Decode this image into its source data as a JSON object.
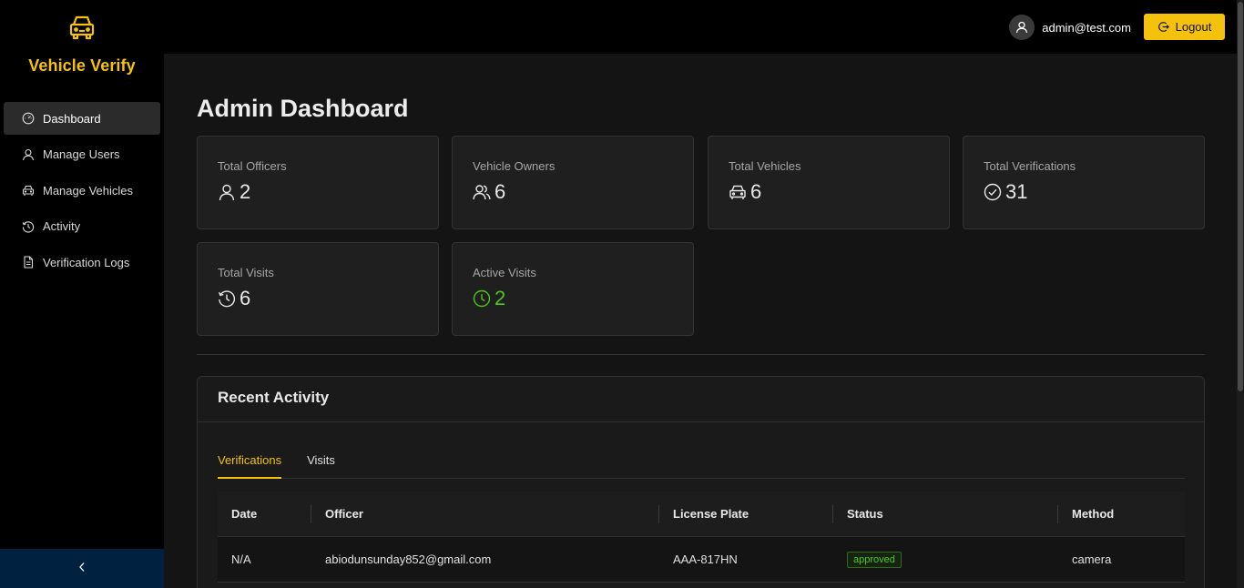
{
  "sidebar": {
    "brand": "Vehicle Verify",
    "items": [
      {
        "label": "Dashboard",
        "icon": "dashboard-icon",
        "active": true
      },
      {
        "label": "Manage Users",
        "icon": "user-icon"
      },
      {
        "label": "Manage Vehicles",
        "icon": "car-icon"
      },
      {
        "label": "Activity",
        "icon": "history-icon"
      },
      {
        "label": "Verification Logs",
        "icon": "file-icon"
      }
    ],
    "collapse_icon": "chevron-left-icon"
  },
  "header": {
    "user_email": "admin@test.com",
    "logout_label": "Logout"
  },
  "main": {
    "title": "Admin Dashboard",
    "stats": [
      {
        "label": "Total Officers",
        "value": "2",
        "icon": "user-icon"
      },
      {
        "label": "Vehicle Owners",
        "value": "6",
        "icon": "team-icon"
      },
      {
        "label": "Total Vehicles",
        "value": "6",
        "icon": "car-icon"
      },
      {
        "label": "Total Verifications",
        "value": "31",
        "icon": "check-circle-icon"
      },
      {
        "label": "Total Visits",
        "value": "6",
        "icon": "history-icon"
      },
      {
        "label": "Active Visits",
        "value": "2",
        "icon": "clock-icon",
        "color": "#52c41a"
      }
    ],
    "recent_activity": {
      "title": "Recent Activity",
      "tabs": [
        "Verifications",
        "Visits"
      ],
      "active_tab": "Verifications",
      "columns": [
        "Date",
        "Officer",
        "License Plate",
        "Status",
        "Method"
      ],
      "rows": [
        {
          "date": "N/A",
          "officer": "abiodunsunday852@gmail.com",
          "plate": "AAA-817HN",
          "status": "approved",
          "method": "camera"
        }
      ]
    }
  },
  "colors": {
    "accent": "#f4c20d",
    "success": "#52c41a",
    "sidebar_bg": "#000000",
    "collapse_bg": "#002140"
  }
}
